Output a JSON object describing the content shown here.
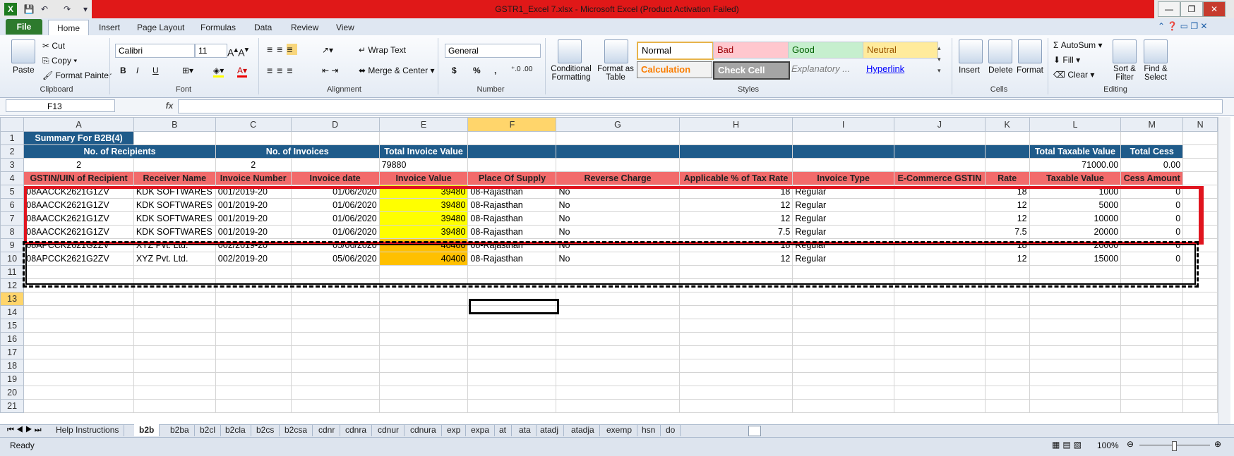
{
  "window": {
    "title": "GSTR1_Excel 7.xlsx  -  Microsoft Excel (Product Activation Failed)"
  },
  "ribbon_tabs": [
    "File",
    "Home",
    "Insert",
    "Page Layout",
    "Formulas",
    "Data",
    "Review",
    "View"
  ],
  "clipboard": {
    "paste": "Paste",
    "cut": "Cut",
    "copy": "Copy",
    "format_painter": "Format Painter",
    "label": "Clipboard"
  },
  "font": {
    "name": "Calibri",
    "size": "11",
    "label": "Font",
    "bold": "B",
    "italic": "I",
    "underline": "U"
  },
  "alignment": {
    "wrap": "Wrap Text",
    "merge": "Merge & Center",
    "label": "Alignment"
  },
  "number": {
    "format": "General",
    "label": "Number",
    "currency": "$",
    "percent": "%",
    "comma": ","
  },
  "styles": {
    "conditional": "Conditional Formatting",
    "format_table": "Format as Table",
    "label": "Styles",
    "cells": [
      "Normal",
      "Bad",
      "Good",
      "Neutral",
      "Calculation",
      "Check Cell",
      "Explanatory ...",
      "Hyperlink"
    ]
  },
  "cells_group": {
    "insert": "Insert",
    "delete": "Delete",
    "format": "Format",
    "label": "Cells"
  },
  "editing": {
    "autosum": "AutoSum",
    "fill": "Fill",
    "clear": "Clear",
    "sort": "Sort & Filter",
    "find": "Find & Select",
    "label": "Editing"
  },
  "formula_bar": {
    "name_box": "F13",
    "fx": "fx",
    "value": ""
  },
  "columns": [
    "A",
    "B",
    "C",
    "D",
    "E",
    "F",
    "G",
    "H",
    "I",
    "J",
    "K",
    "L",
    "M",
    "N"
  ],
  "rows": {
    "r1": {
      "a": "Summary For B2B(4)"
    },
    "r2": {
      "a": "No. of Recipients",
      "c": "No. of Invoices",
      "e": "Total Invoice Value",
      "l": "Total Taxable Value",
      "m": "Total Cess"
    },
    "r3": {
      "a": "2",
      "c": "2",
      "e": "79880",
      "l": "71000.00",
      "m": "0.00"
    },
    "r4": [
      "GSTIN/UIN of Recipient",
      "Receiver Name",
      "Invoice Number",
      "Invoice date",
      "Invoice Value",
      "Place Of Supply",
      "Reverse Charge",
      "Applicable % of Tax Rate",
      "Invoice Type",
      "E-Commerce GSTIN",
      "Rate",
      "Taxable Value",
      "Cess Amount"
    ],
    "data": [
      [
        "08AACCK2621G1ZV",
        "KDK SOFTWARES",
        "001/2019-20",
        "01/06/2020",
        "39480",
        "08-Rajasthan",
        "No",
        "18",
        "Regular",
        "",
        "18",
        "1000",
        "0"
      ],
      [
        "08AACCK2621G1ZV",
        "KDK SOFTWARES",
        "001/2019-20",
        "01/06/2020",
        "39480",
        "08-Rajasthan",
        "No",
        "12",
        "Regular",
        "",
        "12",
        "5000",
        "0"
      ],
      [
        "08AACCK2621G1ZV",
        "KDK SOFTWARES",
        "001/2019-20",
        "01/06/2020",
        "39480",
        "08-Rajasthan",
        "No",
        "12",
        "Regular",
        "",
        "12",
        "10000",
        "0"
      ],
      [
        "08AACCK2621G1ZV",
        "KDK SOFTWARES",
        "001/2019-20",
        "01/06/2020",
        "39480",
        "08-Rajasthan",
        "No",
        "7.5",
        "Regular",
        "",
        "7.5",
        "20000",
        "0"
      ],
      [
        "08APCCK2621G2ZV",
        "XYZ Pvt. Ltd.",
        "002/2019-20",
        "05/06/2020",
        "40400",
        "08-Rajasthan",
        "No",
        "18",
        "Regular",
        "",
        "18",
        "20000",
        "0"
      ],
      [
        "08APCCK2621G2ZV",
        "XYZ Pvt. Ltd.",
        "002/2019-20",
        "05/06/2020",
        "40400",
        "08-Rajasthan",
        "No",
        "12",
        "Regular",
        "",
        "12",
        "15000",
        "0"
      ]
    ]
  },
  "row_numbers": [
    "1",
    "2",
    "3",
    "4",
    "5",
    "6",
    "7",
    "8",
    "9",
    "10",
    "11",
    "12",
    "13",
    "14",
    "15",
    "16",
    "17",
    "18",
    "19",
    "20",
    "21"
  ],
  "sheet_tabs": [
    "Help Instructions",
    "b2b",
    "b2ba",
    "b2cl",
    "b2cla",
    "b2cs",
    "b2csa",
    "cdnr",
    "cdnra",
    "cdnur",
    "cdnura",
    "exp",
    "expa",
    "at",
    "ata",
    "atadj",
    "atadja",
    "exemp",
    "hsn",
    "do"
  ],
  "status": {
    "ready": "Ready",
    "zoom": "100%"
  }
}
